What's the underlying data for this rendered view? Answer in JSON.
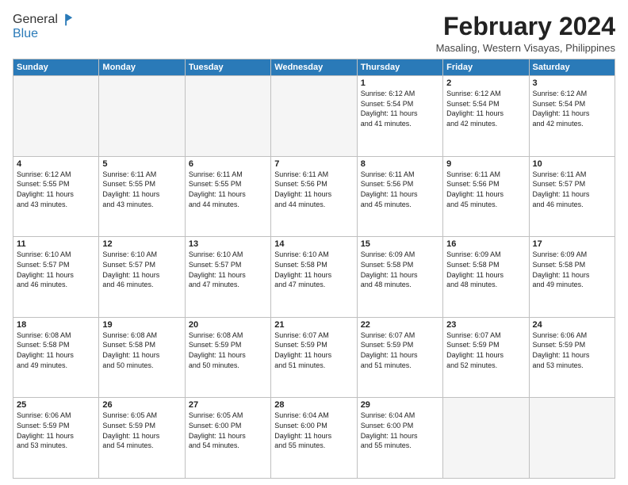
{
  "logo": {
    "general": "General",
    "blue": "Blue"
  },
  "title": "February 2024",
  "location": "Masaling, Western Visayas, Philippines",
  "days_header": [
    "Sunday",
    "Monday",
    "Tuesday",
    "Wednesday",
    "Thursday",
    "Friday",
    "Saturday"
  ],
  "weeks": [
    [
      {
        "day": "",
        "info": ""
      },
      {
        "day": "",
        "info": ""
      },
      {
        "day": "",
        "info": ""
      },
      {
        "day": "",
        "info": ""
      },
      {
        "day": "1",
        "info": "Sunrise: 6:12 AM\nSunset: 5:54 PM\nDaylight: 11 hours\nand 41 minutes."
      },
      {
        "day": "2",
        "info": "Sunrise: 6:12 AM\nSunset: 5:54 PM\nDaylight: 11 hours\nand 42 minutes."
      },
      {
        "day": "3",
        "info": "Sunrise: 6:12 AM\nSunset: 5:54 PM\nDaylight: 11 hours\nand 42 minutes."
      }
    ],
    [
      {
        "day": "4",
        "info": "Sunrise: 6:12 AM\nSunset: 5:55 PM\nDaylight: 11 hours\nand 43 minutes."
      },
      {
        "day": "5",
        "info": "Sunrise: 6:11 AM\nSunset: 5:55 PM\nDaylight: 11 hours\nand 43 minutes."
      },
      {
        "day": "6",
        "info": "Sunrise: 6:11 AM\nSunset: 5:55 PM\nDaylight: 11 hours\nand 44 minutes."
      },
      {
        "day": "7",
        "info": "Sunrise: 6:11 AM\nSunset: 5:56 PM\nDaylight: 11 hours\nand 44 minutes."
      },
      {
        "day": "8",
        "info": "Sunrise: 6:11 AM\nSunset: 5:56 PM\nDaylight: 11 hours\nand 45 minutes."
      },
      {
        "day": "9",
        "info": "Sunrise: 6:11 AM\nSunset: 5:56 PM\nDaylight: 11 hours\nand 45 minutes."
      },
      {
        "day": "10",
        "info": "Sunrise: 6:11 AM\nSunset: 5:57 PM\nDaylight: 11 hours\nand 46 minutes."
      }
    ],
    [
      {
        "day": "11",
        "info": "Sunrise: 6:10 AM\nSunset: 5:57 PM\nDaylight: 11 hours\nand 46 minutes."
      },
      {
        "day": "12",
        "info": "Sunrise: 6:10 AM\nSunset: 5:57 PM\nDaylight: 11 hours\nand 46 minutes."
      },
      {
        "day": "13",
        "info": "Sunrise: 6:10 AM\nSunset: 5:57 PM\nDaylight: 11 hours\nand 47 minutes."
      },
      {
        "day": "14",
        "info": "Sunrise: 6:10 AM\nSunset: 5:58 PM\nDaylight: 11 hours\nand 47 minutes."
      },
      {
        "day": "15",
        "info": "Sunrise: 6:09 AM\nSunset: 5:58 PM\nDaylight: 11 hours\nand 48 minutes."
      },
      {
        "day": "16",
        "info": "Sunrise: 6:09 AM\nSunset: 5:58 PM\nDaylight: 11 hours\nand 48 minutes."
      },
      {
        "day": "17",
        "info": "Sunrise: 6:09 AM\nSunset: 5:58 PM\nDaylight: 11 hours\nand 49 minutes."
      }
    ],
    [
      {
        "day": "18",
        "info": "Sunrise: 6:08 AM\nSunset: 5:58 PM\nDaylight: 11 hours\nand 49 minutes."
      },
      {
        "day": "19",
        "info": "Sunrise: 6:08 AM\nSunset: 5:58 PM\nDaylight: 11 hours\nand 50 minutes."
      },
      {
        "day": "20",
        "info": "Sunrise: 6:08 AM\nSunset: 5:59 PM\nDaylight: 11 hours\nand 50 minutes."
      },
      {
        "day": "21",
        "info": "Sunrise: 6:07 AM\nSunset: 5:59 PM\nDaylight: 11 hours\nand 51 minutes."
      },
      {
        "day": "22",
        "info": "Sunrise: 6:07 AM\nSunset: 5:59 PM\nDaylight: 11 hours\nand 51 minutes."
      },
      {
        "day": "23",
        "info": "Sunrise: 6:07 AM\nSunset: 5:59 PM\nDaylight: 11 hours\nand 52 minutes."
      },
      {
        "day": "24",
        "info": "Sunrise: 6:06 AM\nSunset: 5:59 PM\nDaylight: 11 hours\nand 53 minutes."
      }
    ],
    [
      {
        "day": "25",
        "info": "Sunrise: 6:06 AM\nSunset: 5:59 PM\nDaylight: 11 hours\nand 53 minutes."
      },
      {
        "day": "26",
        "info": "Sunrise: 6:05 AM\nSunset: 5:59 PM\nDaylight: 11 hours\nand 54 minutes."
      },
      {
        "day": "27",
        "info": "Sunrise: 6:05 AM\nSunset: 6:00 PM\nDaylight: 11 hours\nand 54 minutes."
      },
      {
        "day": "28",
        "info": "Sunrise: 6:04 AM\nSunset: 6:00 PM\nDaylight: 11 hours\nand 55 minutes."
      },
      {
        "day": "29",
        "info": "Sunrise: 6:04 AM\nSunset: 6:00 PM\nDaylight: 11 hours\nand 55 minutes."
      },
      {
        "day": "",
        "info": ""
      },
      {
        "day": "",
        "info": ""
      }
    ]
  ],
  "empty_days_week1": [
    0,
    1,
    2,
    3
  ],
  "empty_days_week5": [
    5,
    6
  ]
}
